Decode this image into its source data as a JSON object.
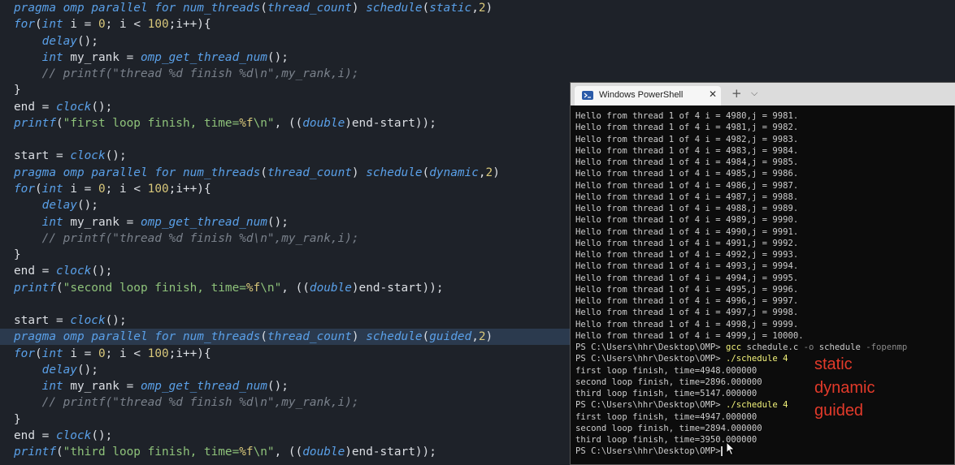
{
  "editor": {
    "lines": [
      [
        {
          "t": "pragma",
          "c": "kw"
        },
        {
          "t": " omp ",
          "c": "kw"
        },
        {
          "t": "parallel for ",
          "c": "kw"
        },
        {
          "t": "num_threads",
          "c": "fn"
        },
        {
          "t": "(",
          "c": "op"
        },
        {
          "t": "thread_count",
          "c": "kw"
        },
        {
          "t": ") ",
          "c": "op"
        },
        {
          "t": "schedule",
          "c": "fn"
        },
        {
          "t": "(",
          "c": "op"
        },
        {
          "t": "static",
          "c": "kw"
        },
        {
          "t": ",",
          "c": "op"
        },
        {
          "t": "2",
          "c": "num"
        },
        {
          "t": ")",
          "c": "op"
        }
      ],
      [
        {
          "t": "for",
          "c": "kw"
        },
        {
          "t": "(",
          "c": "op"
        },
        {
          "t": "int",
          "c": "type"
        },
        {
          "t": " i = ",
          "c": "op"
        },
        {
          "t": "0",
          "c": "num"
        },
        {
          "t": "; i < ",
          "c": "op"
        },
        {
          "t": "100",
          "c": "num"
        },
        {
          "t": ";i++){",
          "c": "op"
        }
      ],
      [
        {
          "t": "    ",
          "c": "op"
        },
        {
          "t": "delay",
          "c": "fn"
        },
        {
          "t": "();",
          "c": "op"
        }
      ],
      [
        {
          "t": "    ",
          "c": "op"
        },
        {
          "t": "int",
          "c": "type"
        },
        {
          "t": " my_rank = ",
          "c": "op"
        },
        {
          "t": "omp_get_thread_num",
          "c": "fn"
        },
        {
          "t": "();",
          "c": "op"
        }
      ],
      [
        {
          "t": "    // printf(\"thread %d finish %d\\n\",my_rank,i);",
          "c": "cmt"
        }
      ],
      [
        {
          "t": "}",
          "c": "op"
        }
      ],
      [
        {
          "t": "end = ",
          "c": "op"
        },
        {
          "t": "clock",
          "c": "fn"
        },
        {
          "t": "();",
          "c": "op"
        }
      ],
      [
        {
          "t": "printf",
          "c": "fn"
        },
        {
          "t": "(",
          "c": "op"
        },
        {
          "t": "\"first loop finish, time=",
          "c": "str"
        },
        {
          "t": "%f",
          "c": "fmt"
        },
        {
          "t": "\\n\"",
          "c": "str"
        },
        {
          "t": ", ((",
          "c": "op"
        },
        {
          "t": "double",
          "c": "type"
        },
        {
          "t": ")end-start));",
          "c": "op"
        }
      ],
      [],
      [
        {
          "t": "start = ",
          "c": "op"
        },
        {
          "t": "clock",
          "c": "fn"
        },
        {
          "t": "();",
          "c": "op"
        }
      ],
      [
        {
          "t": "pragma",
          "c": "kw"
        },
        {
          "t": " omp ",
          "c": "kw"
        },
        {
          "t": "parallel for ",
          "c": "kw"
        },
        {
          "t": "num_threads",
          "c": "fn"
        },
        {
          "t": "(",
          "c": "op"
        },
        {
          "t": "thread_count",
          "c": "kw"
        },
        {
          "t": ") ",
          "c": "op"
        },
        {
          "t": "schedule",
          "c": "fn"
        },
        {
          "t": "(",
          "c": "op"
        },
        {
          "t": "dynamic",
          "c": "kw"
        },
        {
          "t": ",",
          "c": "op"
        },
        {
          "t": "2",
          "c": "num"
        },
        {
          "t": ")",
          "c": "op"
        }
      ],
      [
        {
          "t": "for",
          "c": "kw"
        },
        {
          "t": "(",
          "c": "op"
        },
        {
          "t": "int",
          "c": "type"
        },
        {
          "t": " i = ",
          "c": "op"
        },
        {
          "t": "0",
          "c": "num"
        },
        {
          "t": "; i < ",
          "c": "op"
        },
        {
          "t": "100",
          "c": "num"
        },
        {
          "t": ";i++){",
          "c": "op"
        }
      ],
      [
        {
          "t": "    ",
          "c": "op"
        },
        {
          "t": "delay",
          "c": "fn"
        },
        {
          "t": "();",
          "c": "op"
        }
      ],
      [
        {
          "t": "    ",
          "c": "op"
        },
        {
          "t": "int",
          "c": "type"
        },
        {
          "t": " my_rank = ",
          "c": "op"
        },
        {
          "t": "omp_get_thread_num",
          "c": "fn"
        },
        {
          "t": "();",
          "c": "op"
        }
      ],
      [
        {
          "t": "    // printf(\"thread %d finish %d\\n\",my_rank,i);",
          "c": "cmt"
        }
      ],
      [
        {
          "t": "}",
          "c": "op"
        }
      ],
      [
        {
          "t": "end = ",
          "c": "op"
        },
        {
          "t": "clock",
          "c": "fn"
        },
        {
          "t": "();",
          "c": "op"
        }
      ],
      [
        {
          "t": "printf",
          "c": "fn"
        },
        {
          "t": "(",
          "c": "op"
        },
        {
          "t": "\"second loop finish, time=",
          "c": "str"
        },
        {
          "t": "%f",
          "c": "fmt"
        },
        {
          "t": "\\n\"",
          "c": "str"
        },
        {
          "t": ", ((",
          "c": "op"
        },
        {
          "t": "double",
          "c": "type"
        },
        {
          "t": ")end-start));",
          "c": "op"
        }
      ],
      [],
      [
        {
          "t": "start = ",
          "c": "op"
        },
        {
          "t": "clock",
          "c": "fn"
        },
        {
          "t": "();",
          "c": "op"
        }
      ],
      [
        {
          "t": "pragma",
          "c": "kw"
        },
        {
          "t": " omp ",
          "c": "kw"
        },
        {
          "t": "parallel for ",
          "c": "kw"
        },
        {
          "t": "num_threads",
          "c": "fn"
        },
        {
          "t": "(",
          "c": "op"
        },
        {
          "t": "thread_count",
          "c": "kw"
        },
        {
          "t": ") ",
          "c": "op"
        },
        {
          "t": "schedule",
          "c": "fn"
        },
        {
          "t": "(",
          "c": "op"
        },
        {
          "t": "guided",
          "c": "kw"
        },
        {
          "t": ",",
          "c": "op"
        },
        {
          "t": "2",
          "c": "num"
        },
        {
          "t": ")",
          "c": "op"
        }
      ],
      [
        {
          "t": "for",
          "c": "kw"
        },
        {
          "t": "(",
          "c": "op"
        },
        {
          "t": "int",
          "c": "type"
        },
        {
          "t": " i = ",
          "c": "op"
        },
        {
          "t": "0",
          "c": "num"
        },
        {
          "t": "; i < ",
          "c": "op"
        },
        {
          "t": "100",
          "c": "num"
        },
        {
          "t": ";i++){",
          "c": "op"
        }
      ],
      [
        {
          "t": "    ",
          "c": "op"
        },
        {
          "t": "delay",
          "c": "fn"
        },
        {
          "t": "();",
          "c": "op"
        }
      ],
      [
        {
          "t": "    ",
          "c": "op"
        },
        {
          "t": "int",
          "c": "type"
        },
        {
          "t": " my_rank = ",
          "c": "op"
        },
        {
          "t": "omp_get_thread_num",
          "c": "fn"
        },
        {
          "t": "();",
          "c": "op"
        }
      ],
      [
        {
          "t": "    // printf(\"thread %d finish %d\\n\",my_rank,i);",
          "c": "cmt"
        }
      ],
      [
        {
          "t": "}",
          "c": "op"
        }
      ],
      [
        {
          "t": "end = ",
          "c": "op"
        },
        {
          "t": "clock",
          "c": "fn"
        },
        {
          "t": "();",
          "c": "op"
        }
      ],
      [
        {
          "t": "printf",
          "c": "fn"
        },
        {
          "t": "(",
          "c": "op"
        },
        {
          "t": "\"third loop finish, time=",
          "c": "str"
        },
        {
          "t": "%f",
          "c": "fmt"
        },
        {
          "t": "\\n\"",
          "c": "str"
        },
        {
          "t": ", ((",
          "c": "op"
        },
        {
          "t": "double",
          "c": "type"
        },
        {
          "t": ")end-start));",
          "c": "op"
        }
      ]
    ],
    "highlighted_line": 20
  },
  "powershell": {
    "tab_title": "Windows PowerShell",
    "close_glyph": "✕",
    "new_tab_glyph": "+",
    "dropdown_glyph": "⌵",
    "output": [
      "Hello from thread 1 of 4 i = 4980,j = 9981.",
      "Hello from thread 1 of 4 i = 4981,j = 9982.",
      "Hello from thread 1 of 4 i = 4982,j = 9983.",
      "Hello from thread 1 of 4 i = 4983,j = 9984.",
      "Hello from thread 1 of 4 i = 4984,j = 9985.",
      "Hello from thread 1 of 4 i = 4985,j = 9986.",
      "Hello from thread 1 of 4 i = 4986,j = 9987.",
      "Hello from thread 1 of 4 i = 4987,j = 9988.",
      "Hello from thread 1 of 4 i = 4988,j = 9989.",
      "Hello from thread 1 of 4 i = 4989,j = 9990.",
      "Hello from thread 1 of 4 i = 4990,j = 9991.",
      "Hello from thread 1 of 4 i = 4991,j = 9992.",
      "Hello from thread 1 of 4 i = 4992,j = 9993.",
      "Hello from thread 1 of 4 i = 4993,j = 9994.",
      "Hello from thread 1 of 4 i = 4994,j = 9995.",
      "Hello from thread 1 of 4 i = 4995,j = 9996.",
      "Hello from thread 1 of 4 i = 4996,j = 9997.",
      "Hello from thread 1 of 4 i = 4997,j = 9998.",
      "Hello from thread 1 of 4 i = 4998,j = 9999.",
      "Hello from thread 1 of 4 i = 4999,j = 10000."
    ],
    "gcc_command": {
      "prompt": "PS C:\\Users\\hhr\\Desktop\\OMP> ",
      "cmd": "gcc",
      "args": " schedule.c ",
      "flag1": "-o",
      "args2": " schedule ",
      "flag2": "-fopenmp"
    },
    "run1": {
      "prompt": "PS C:\\Users\\hhr\\Desktop\\OMP> ",
      "command": "./schedule 4",
      "lines": [
        "first loop finish, time=4948.000000",
        "second loop finish, time=2896.000000",
        "third loop finish, time=5147.000000"
      ]
    },
    "run2": {
      "prompt": "PS C:\\Users\\hhr\\Desktop\\OMP> ",
      "command": "./schedule 4",
      "lines": [
        "first loop finish, time=4947.000000",
        "second loop finish, time=2894.000000",
        "third loop finish, time=3950.000000"
      ]
    },
    "final_prompt": "PS C:\\Users\\hhr\\Desktop\\OMP>"
  },
  "annotation": {
    "lines": [
      "static",
      "dynamic",
      "guided"
    ],
    "color": "#e23a2a"
  }
}
